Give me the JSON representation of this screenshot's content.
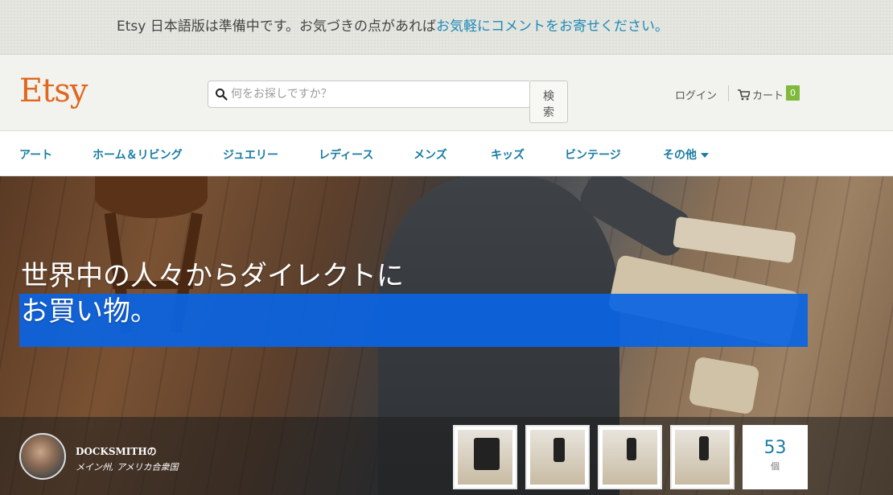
{
  "notice": {
    "text": "Etsy 日本語版は準備中です。お気づきの点があれば",
    "link": "お気軽にコメントをお寄せください。"
  },
  "header": {
    "logo": "Etsy",
    "search_placeholder": "何をお探しですか？",
    "search_button": "検索",
    "login": "ログイン",
    "cart_label": "カート",
    "cart_count": "0"
  },
  "categories": [
    "アート",
    "ホーム＆リビング",
    "ジュエリー",
    "レディース",
    "メンズ",
    "キッズ",
    "ビンテージ",
    "その他"
  ],
  "hero": {
    "title_line1": "世界中の人々からダイレクトに",
    "title_line2": "お買い物。"
  },
  "shop": {
    "name": "DOCKSMITHの",
    "location": "メイン州, アメリカ合衆国",
    "item_count": "53",
    "item_count_label": "個"
  },
  "colors": {
    "brand": "#e0671d",
    "link": "#1a7da3",
    "cart_badge": "#7fba3a",
    "hero_highlight": "#0a64e3"
  }
}
